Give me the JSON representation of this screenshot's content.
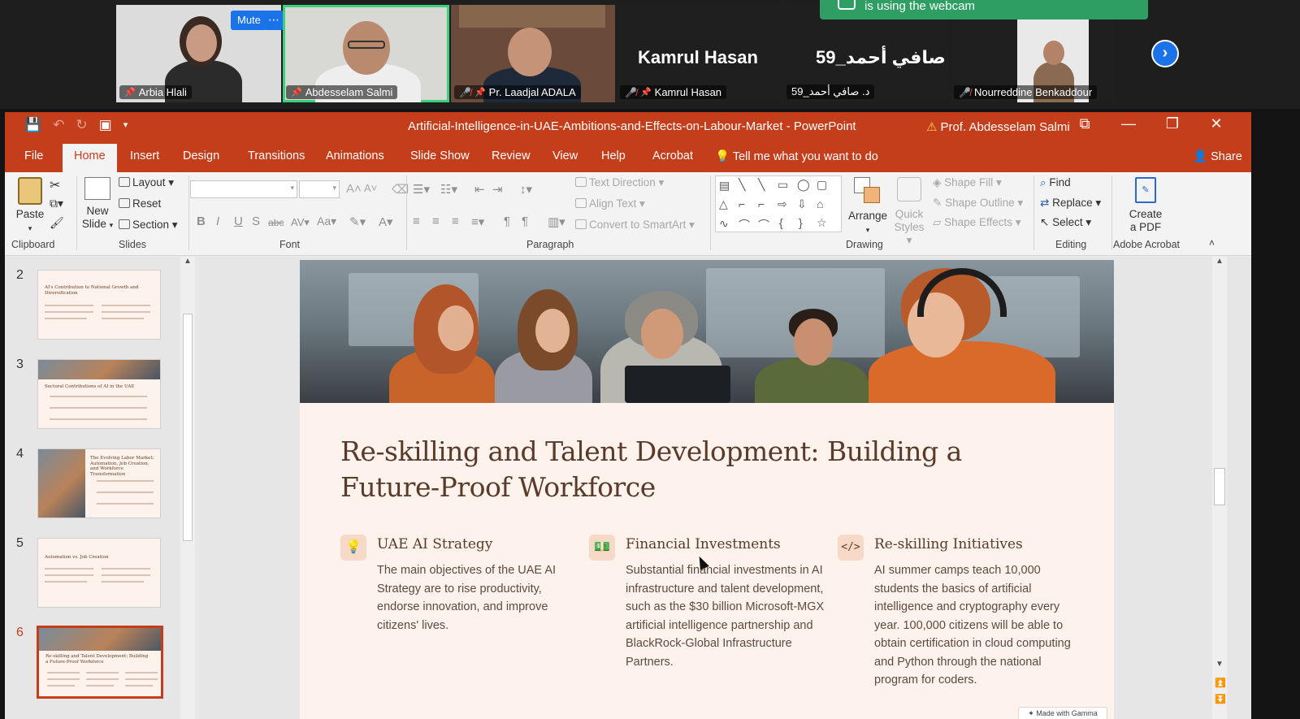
{
  "meeting": {
    "mute_label": "Mute",
    "more_label": "⋯",
    "toast": "is using the webcam",
    "participants": [
      {
        "name": "Arbia Hlali"
      },
      {
        "name": "Abdesselam Salmi"
      },
      {
        "name": "Pr. Laadjal ADALA"
      },
      {
        "name": "Kamrul Hasan",
        "big_name": "Kamrul Hasan"
      },
      {
        "name": "د. صافي أحمد_59",
        "big_name": "د. صافي أحمد_59"
      },
      {
        "name": "Nourreddine Benkaddour"
      }
    ],
    "next_label": "›"
  },
  "window": {
    "doc_title": "Artificial-Intelligence-in-UAE-Ambitions-and-Effects-on-Labour-Market  -  PowerPoint",
    "user": "Prof. Abdesselam Salmi"
  },
  "tabs": [
    "File",
    "Home",
    "Insert",
    "Design",
    "Transitions",
    "Animations",
    "Slide Show",
    "Review",
    "View",
    "Help",
    "Acrobat"
  ],
  "tell_me": "Tell me what you want to do",
  "share": "Share",
  "ribbon": {
    "paste": "Paste",
    "clipboard": "Clipboard",
    "new_slide_1": "New",
    "new_slide_2": "Slide",
    "layout": "Layout",
    "reset": "Reset",
    "section": "Section",
    "slides": "Slides",
    "font": "Font",
    "text_direction": "Text Direction",
    "align_text": "Align Text",
    "convert_smartart": "Convert to SmartArt",
    "paragraph": "Paragraph",
    "arrange": "Arrange",
    "quick_styles_1": "Quick",
    "quick_styles_2": "Styles",
    "shape_fill": "Shape Fill",
    "shape_outline": "Shape Outline",
    "shape_effects": "Shape Effects",
    "drawing": "Drawing",
    "find": "Find",
    "replace": "Replace",
    "select": "Select",
    "editing": "Editing",
    "create_pdf_1": "Create",
    "create_pdf_2": "a PDF",
    "adobe_acrobat": "Adobe Acrobat"
  },
  "thumbnails": [
    {
      "num": "2",
      "title": "AI's Contribution to National Growth and Diversification"
    },
    {
      "num": "3",
      "title": "Sectoral Contributions of AI in the UAE"
    },
    {
      "num": "4",
      "title": "The Evolving Labor Market: Automation, Job Creation, and Workforce Transformation"
    },
    {
      "num": "5",
      "title": "Automation vs. Job Creation"
    },
    {
      "num": "6",
      "title": "Re-skilling and Talent Development: Building a Future-Proof Workforce"
    }
  ],
  "slide": {
    "title": "Re-skilling and Talent Development: Building a Future-Proof Workforce",
    "columns": [
      {
        "heading": "UAE AI Strategy",
        "icon": "lightbulb-icon",
        "body": "The main objectives of the UAE AI Strategy are to rise productivity, endorse innovation, and improve citizens' lives."
      },
      {
        "heading": "Financial Investments",
        "icon": "money-icon",
        "body": "Substantial financial investments in AI infrastructure and talent development, such as the $30 billion Microsoft-MGX artificial intelligence partnership and BlackRock-Global Infrastructure Partners."
      },
      {
        "heading": "Re-skilling Initiatives",
        "icon": "code-icon",
        "body": "AI summer camps teach 10,000 students the basics of artificial intelligence and cryptography every year. 100,000 citizens will be able to obtain certification in cloud computing and Python through the national program for coders."
      }
    ],
    "badge": "Made with Gamma"
  },
  "colors": {
    "accent": "#c43e1c",
    "slide_bg": "#fdf3ec",
    "title_text": "#5a3a2a"
  }
}
